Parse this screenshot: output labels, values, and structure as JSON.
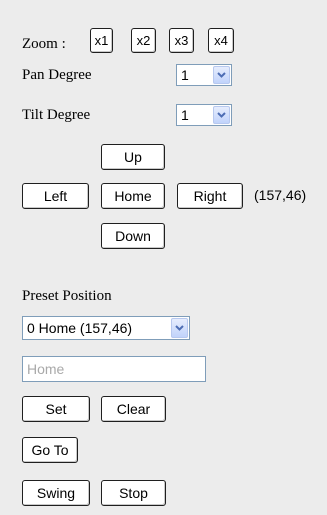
{
  "zoom": {
    "label": "Zoom :",
    "buttons": [
      "x1",
      "x2",
      "x3",
      "x4"
    ]
  },
  "pan": {
    "label": "Pan Degree",
    "value": "1"
  },
  "tilt": {
    "label": "Tilt Degree",
    "value": "1"
  },
  "navigation": {
    "up": "Up",
    "left": "Left",
    "home": "Home",
    "right": "Right",
    "down": "Down",
    "coordinates": "(157,46)"
  },
  "preset": {
    "label": "Preset Position",
    "selected": "0 Home (157,46)",
    "name_placeholder": "Home",
    "set": "Set",
    "clear": "Clear",
    "goto": "Go To",
    "swing": "Swing",
    "stop": "Stop"
  },
  "icons": {
    "dropdown_arrow": "chevron-down-icon"
  },
  "colors": {
    "background": "#ececec",
    "arrow_blue": "#4d6db4",
    "field_border": "#7f9db9"
  }
}
